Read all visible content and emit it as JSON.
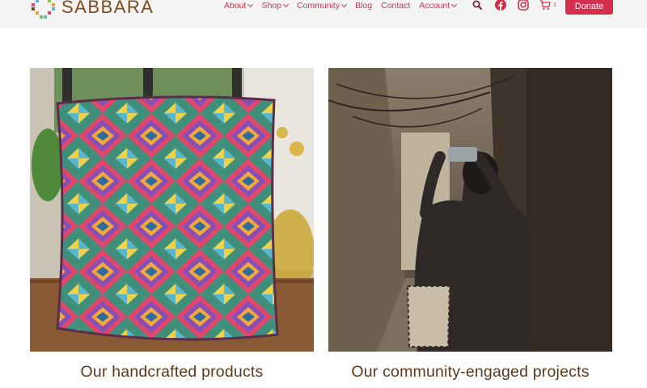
{
  "brand": {
    "name": "SABBARA",
    "color": "#7a4a1e"
  },
  "nav": {
    "items": [
      {
        "label": "About",
        "has_dropdown": true
      },
      {
        "label": "Shop",
        "has_dropdown": true
      },
      {
        "label": "Community",
        "has_dropdown": true
      },
      {
        "label": "Blog",
        "has_dropdown": false
      },
      {
        "label": "Contact",
        "has_dropdown": false
      },
      {
        "label": "Account",
        "has_dropdown": true
      }
    ],
    "color": "#d0304b"
  },
  "header_icons": [
    "search-icon",
    "facebook-icon",
    "instagram-icon",
    "cart-icon"
  ],
  "cart": {
    "count": "1"
  },
  "donate": {
    "label": "Donate",
    "color": "#d42f4d"
  },
  "cards": [
    {
      "title": "Our handcrafted products",
      "image": "embroidered cushion on wooden table"
    },
    {
      "title": "Our community-engaged projects",
      "image": "woman photographing a narrow alley"
    }
  ]
}
